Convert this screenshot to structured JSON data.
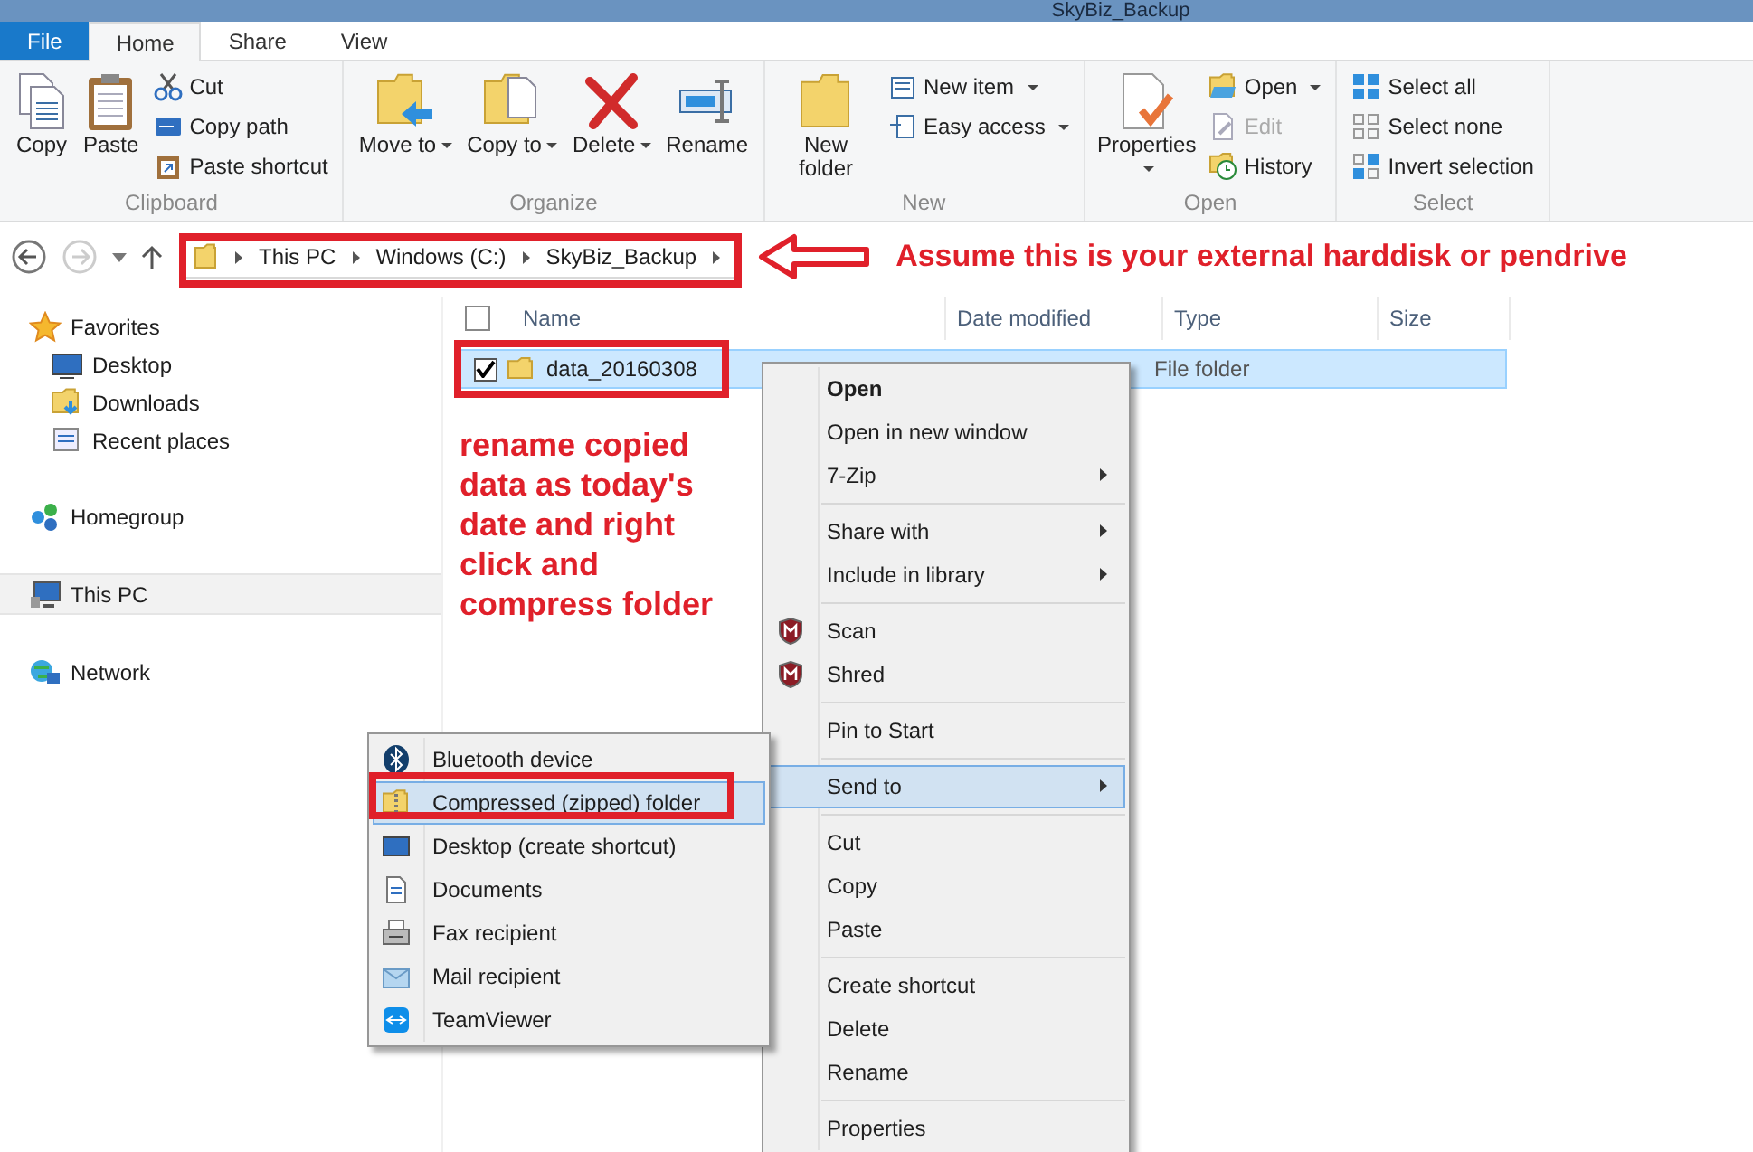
{
  "window": {
    "title": "SkyBiz_Backup"
  },
  "ribbon_tabs": [
    {
      "label": "File",
      "kind": "file",
      "selected": false
    },
    {
      "label": "Home",
      "kind": "tab",
      "selected": true
    },
    {
      "label": "Share",
      "kind": "tab",
      "selected": false
    },
    {
      "label": "View",
      "kind": "tab",
      "selected": false
    }
  ],
  "ribbon_groups": [
    {
      "label": "Clipboard",
      "large": [
        {
          "label": "Copy",
          "dropdown": false
        },
        {
          "label": "Paste",
          "dropdown": false
        }
      ],
      "small": [
        {
          "label": "Cut",
          "dropdown": false,
          "disabled": false
        },
        {
          "label": "Copy path",
          "dropdown": false,
          "disabled": false
        },
        {
          "label": "Paste shortcut",
          "dropdown": false,
          "disabled": false
        }
      ]
    },
    {
      "label": "Organize",
      "large": [
        {
          "label": "Move to",
          "dropdown": true
        },
        {
          "label": "Copy to",
          "dropdown": true
        },
        {
          "label": "Delete",
          "dropdown": true
        },
        {
          "label": "Rename",
          "dropdown": false
        }
      ]
    },
    {
      "label": "New",
      "large": [
        {
          "label": "New folder",
          "dropdown": false
        }
      ],
      "small": [
        {
          "label": "New item",
          "dropdown": true,
          "disabled": false
        },
        {
          "label": "Easy access",
          "dropdown": true,
          "disabled": false
        }
      ]
    },
    {
      "label": "Open",
      "large": [
        {
          "label": "Properties",
          "dropdown": true
        }
      ],
      "small": [
        {
          "label": "Open",
          "dropdown": true,
          "disabled": false
        },
        {
          "label": "Edit",
          "dropdown": false,
          "disabled": true
        },
        {
          "label": "History",
          "dropdown": false,
          "disabled": false
        }
      ]
    },
    {
      "label": "Select",
      "small": [
        {
          "label": "Select all",
          "dropdown": false,
          "disabled": false
        },
        {
          "label": "Select none",
          "dropdown": false,
          "disabled": false
        },
        {
          "label": "Invert selection",
          "dropdown": false,
          "disabled": false
        }
      ]
    }
  ],
  "breadcrumb": [
    "This PC",
    "Windows (C:)",
    "SkyBiz_Backup"
  ],
  "navigation": [
    {
      "label": "Favorites",
      "selected": false,
      "children": [
        {
          "label": "Desktop",
          "selected": false
        },
        {
          "label": "Downloads",
          "selected": false
        },
        {
          "label": "Recent places",
          "selected": false
        }
      ]
    },
    {
      "label": "Homegroup",
      "selected": false
    },
    {
      "label": "This PC",
      "selected": true
    },
    {
      "label": "Network",
      "selected": false
    }
  ],
  "select_all_checked": false,
  "columns": [
    "Name",
    "Date modified",
    "Type",
    "Size"
  ],
  "rows": [
    {
      "name": "data_20160308",
      "type": "File folder",
      "checked": true,
      "selected": true
    }
  ],
  "context_menu": [
    [
      {
        "label": "Open",
        "default": true,
        "submenu": false,
        "selected": false
      },
      {
        "label": "Open in new window",
        "default": false,
        "submenu": false,
        "selected": false
      },
      {
        "label": "7-Zip",
        "default": false,
        "submenu": true,
        "selected": false
      }
    ],
    [
      {
        "label": "Share with",
        "default": false,
        "submenu": true,
        "selected": false
      },
      {
        "label": "Include in library",
        "default": false,
        "submenu": true,
        "selected": false
      }
    ],
    [
      {
        "label": "Scan",
        "default": false,
        "submenu": false,
        "selected": false
      },
      {
        "label": "Shred",
        "default": false,
        "submenu": false,
        "selected": false
      }
    ],
    [
      {
        "label": "Pin to Start",
        "default": false,
        "submenu": false,
        "selected": false
      }
    ],
    [
      {
        "label": "Send to",
        "default": false,
        "submenu": true,
        "selected": true
      }
    ],
    [
      {
        "label": "Cut",
        "default": false,
        "submenu": false,
        "selected": false
      },
      {
        "label": "Copy",
        "default": false,
        "submenu": false,
        "selected": false
      },
      {
        "label": "Paste",
        "default": false,
        "submenu": false,
        "selected": false
      }
    ],
    [
      {
        "label": "Create shortcut",
        "default": false,
        "submenu": false,
        "selected": false
      },
      {
        "label": "Delete",
        "default": false,
        "submenu": false,
        "selected": false
      },
      {
        "label": "Rename",
        "default": false,
        "submenu": false,
        "selected": false
      }
    ],
    [
      {
        "label": "Properties",
        "default": false,
        "submenu": false,
        "selected": false
      }
    ]
  ],
  "send_to_menu": [
    {
      "label": "Bluetooth device",
      "selected": false
    },
    {
      "label": "Compressed (zipped) folder",
      "selected": true
    },
    {
      "label": "Desktop (create shortcut)",
      "selected": false
    },
    {
      "label": "Documents",
      "selected": false
    },
    {
      "label": "Fax recipient",
      "selected": false
    },
    {
      "label": "Mail recipient",
      "selected": false
    },
    {
      "label": "TeamViewer",
      "selected": false
    }
  ],
  "annotations": {
    "address_note": "Assume this is your external harddisk or pendrive",
    "rename_note": "rename copied data as today's date and right click and compress folder"
  }
}
